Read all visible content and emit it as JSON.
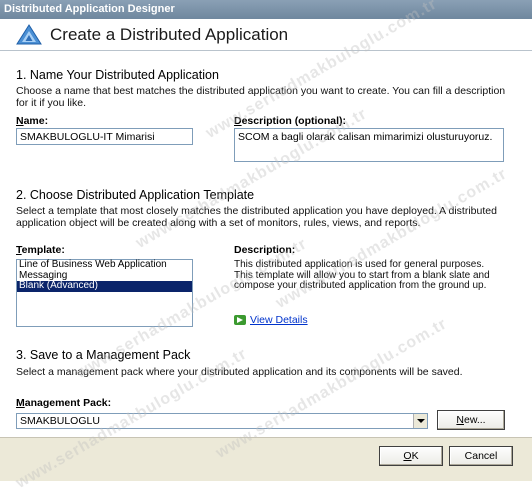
{
  "window": {
    "title": "Distributed Application Designer"
  },
  "header": {
    "title": "Create a Distributed Application"
  },
  "section1": {
    "title": "1. Name Your Distributed Application",
    "description": "Choose a name that best matches the distributed application you want to create. You can fill a description for it if you like.",
    "name_label_accel": "N",
    "name_label_rest": "ame:",
    "name_value": "SMAKBULOGLU-IT Mimarisi",
    "desc_label_accel": "D",
    "desc_label_rest": "escription (optional):",
    "desc_value": "SCOM a bagli olarak calisan mimarimizi olusturuyoruz."
  },
  "section2": {
    "title": "2. Choose Distributed Application Template",
    "description": "Select a template that most closely matches the distributed application you have deployed. A distributed application object will be created along with a set of monitors, rules, views, and reports.",
    "template_label_accel": "T",
    "template_label_rest": "emplate:",
    "templates": [
      "Line of Business Web Application",
      "Messaging",
      "Blank (Advanced)"
    ],
    "selected_index": 2,
    "desc_label": "Description:",
    "template_description": "This distributed application is used for general purposes. This template will allow you to start from a blank slate and compose your distributed application from the ground up.",
    "view_details": "View Details"
  },
  "section3": {
    "title": "3. Save to a Management Pack",
    "description": "Select a management pack where your distributed application and its components will be saved.",
    "mp_label_accel": "M",
    "mp_label_rest": "anagement Pack:",
    "mp_value": "SMAKBULOGLU",
    "new_button_accel": "N",
    "new_button_rest": "ew..."
  },
  "footer": {
    "ok_accel": "O",
    "ok_rest": "K",
    "cancel": "Cancel"
  },
  "watermark": "www.serhadmakbuloglu.com.tr",
  "colors": {
    "titlebar": "#6f879e",
    "selection": "#0a246a",
    "link": "#0033cc",
    "footer_bg": "#ece9d8"
  }
}
